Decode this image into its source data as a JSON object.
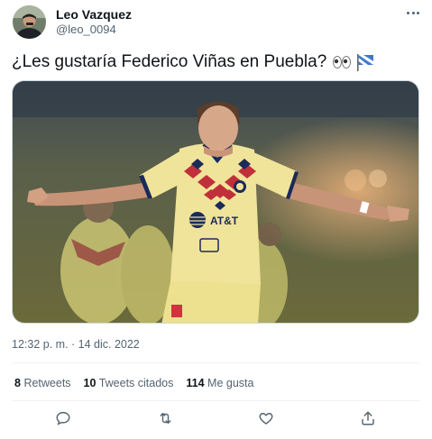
{
  "author": {
    "name": "Leo Vazquez",
    "handle": "@leo_0094"
  },
  "tweet": {
    "text": "¿Les gustaría Federico Viñas en Puebla?",
    "emojis": [
      "eyes-emoji",
      "eyes-emoji",
      "puebla-flag-emoji"
    ],
    "timestamp": "12:32 p. m. · 14 dic. 2022"
  },
  "stats": {
    "retweets_count": "8",
    "retweets_label": "Retweets",
    "quotes_count": "10",
    "quotes_label": "Tweets citados",
    "likes_count": "114",
    "likes_label": "Me gusta"
  },
  "media": {
    "jersey_sponsor": "AT&T"
  },
  "icons": {
    "more": "more-horizontal-icon",
    "reply": "reply-icon",
    "retweet": "retweet-icon",
    "like": "heart-icon",
    "share": "share-icon"
  },
  "colors": {
    "text": "#0f1419",
    "secondary": "#536471",
    "divider": "#eff3f4",
    "jersey": "#f0e49a",
    "jersey_pattern": "#c0303a",
    "jersey_navy": "#1c2a5a"
  }
}
